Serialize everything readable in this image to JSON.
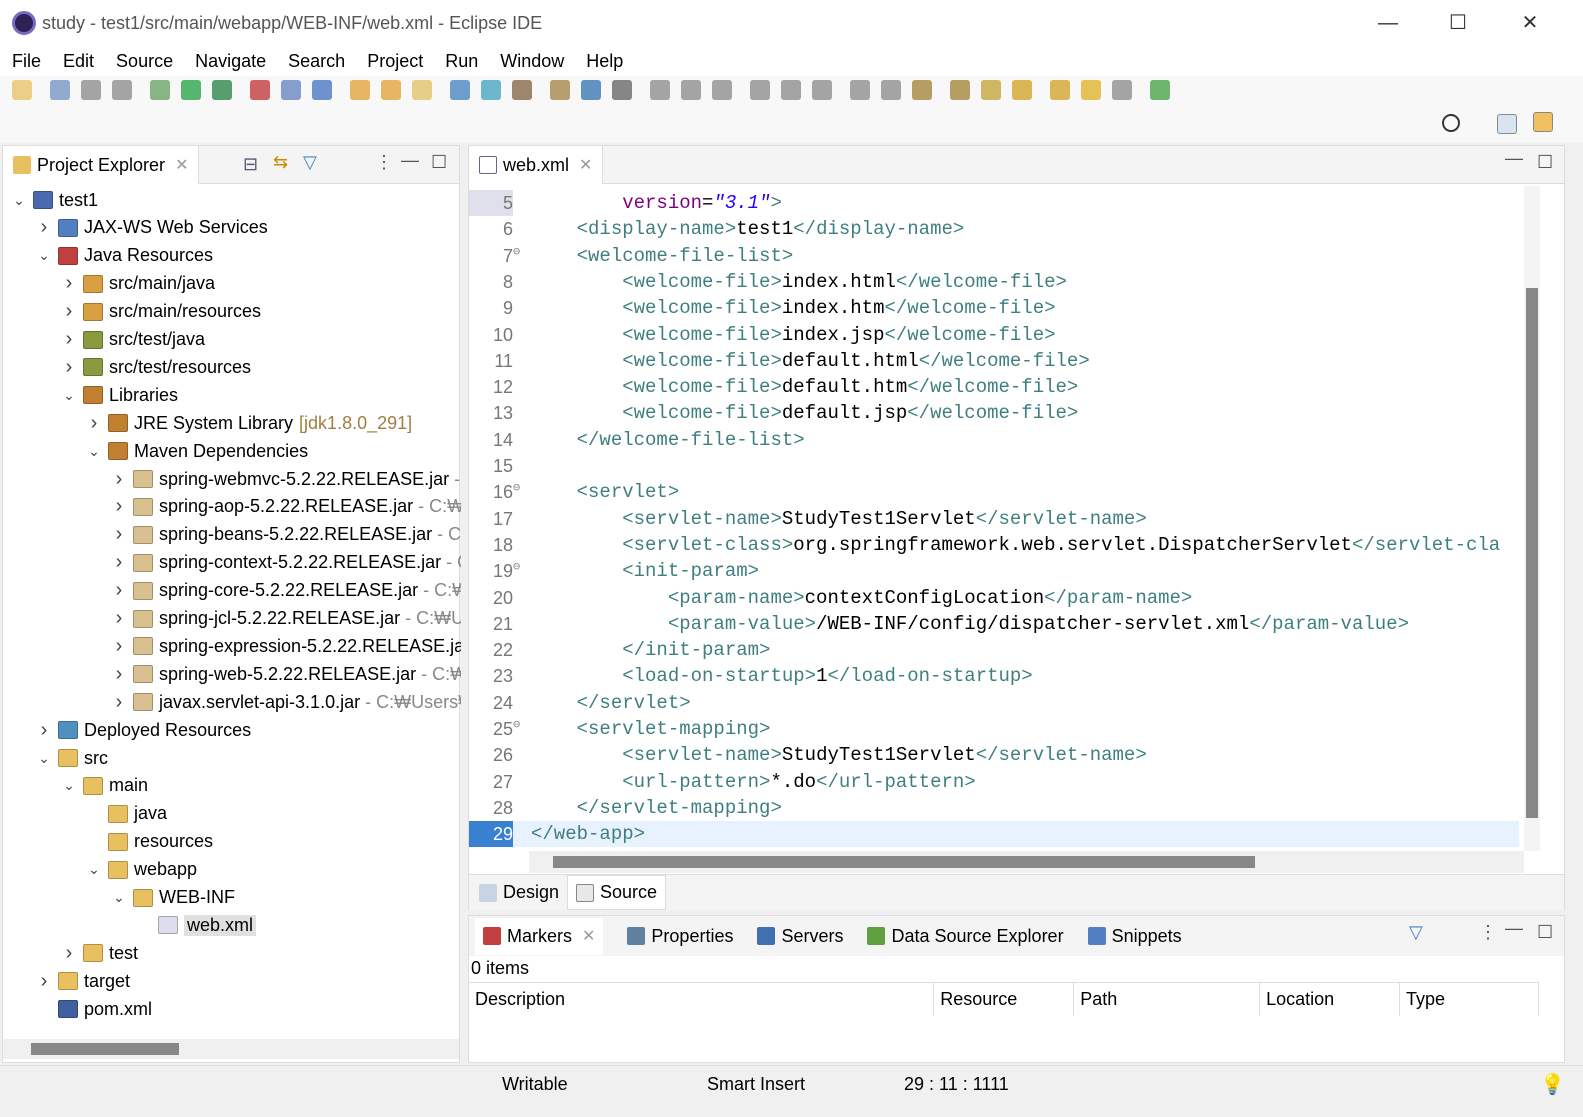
{
  "window": {
    "title": "study - test1/src/main/webapp/WEB-INF/web.xml - Eclipse IDE",
    "minimize": "—",
    "maximize": "☐",
    "close": "✕"
  },
  "menu": [
    "File",
    "Edit",
    "Source",
    "Navigate",
    "Search",
    "Project",
    "Run",
    "Window",
    "Help"
  ],
  "explorer": {
    "tab": "Project Explorer",
    "tree": [
      {
        "d": 0,
        "tw": "v",
        "icon": "project",
        "label": "test1"
      },
      {
        "d": 1,
        "tw": ">",
        "icon": "webservices",
        "label": "JAX-WS Web Services"
      },
      {
        "d": 1,
        "tw": "v",
        "icon": "javares",
        "label": "Java Resources"
      },
      {
        "d": 2,
        "tw": ">",
        "icon": "srcfolder",
        "label": "src/main/java"
      },
      {
        "d": 2,
        "tw": ">",
        "icon": "srcfolder",
        "label": "src/main/resources"
      },
      {
        "d": 2,
        "tw": ">",
        "icon": "testfolder",
        "label": "src/test/java"
      },
      {
        "d": 2,
        "tw": ">",
        "icon": "testfolder",
        "label": "src/test/resources"
      },
      {
        "d": 2,
        "tw": "v",
        "icon": "library",
        "label": "Libraries"
      },
      {
        "d": 3,
        "tw": ">",
        "icon": "library",
        "label": "JRE System Library",
        "jdk": "[jdk1.8.0_291]"
      },
      {
        "d": 3,
        "tw": "v",
        "icon": "library",
        "label": "Maven Dependencies"
      },
      {
        "d": 4,
        "tw": ">",
        "icon": "jar",
        "label": "spring-webmvc-5.2.22.RELEASE.jar",
        "suffix": " -"
      },
      {
        "d": 4,
        "tw": ">",
        "icon": "jar",
        "label": "spring-aop-5.2.22.RELEASE.jar",
        "suffix": " - C:₩U"
      },
      {
        "d": 4,
        "tw": ">",
        "icon": "jar",
        "label": "spring-beans-5.2.22.RELEASE.jar",
        "suffix": " - C:₩"
      },
      {
        "d": 4,
        "tw": ">",
        "icon": "jar",
        "label": "spring-context-5.2.22.RELEASE.jar",
        "suffix": " - C"
      },
      {
        "d": 4,
        "tw": ">",
        "icon": "jar",
        "label": "spring-core-5.2.22.RELEASE.jar",
        "suffix": " - C:₩"
      },
      {
        "d": 4,
        "tw": ">",
        "icon": "jar",
        "label": "spring-jcl-5.2.22.RELEASE.jar",
        "suffix": " - C:₩Us"
      },
      {
        "d": 4,
        "tw": ">",
        "icon": "jar",
        "label": "spring-expression-5.2.22.RELEASE.jar",
        "suffix": ""
      },
      {
        "d": 4,
        "tw": ">",
        "icon": "jar",
        "label": "spring-web-5.2.22.RELEASE.jar",
        "suffix": " - C:₩U"
      },
      {
        "d": 4,
        "tw": ">",
        "icon": "jar",
        "label": "javax.servlet-api-3.1.0.jar",
        "suffix": " - C:₩Users₩"
      },
      {
        "d": 1,
        "tw": ">",
        "icon": "deployed",
        "label": "Deployed Resources"
      },
      {
        "d": 1,
        "tw": "v",
        "icon": "folder",
        "label": "src"
      },
      {
        "d": 2,
        "tw": "v",
        "icon": "folder",
        "label": "main"
      },
      {
        "d": 3,
        "tw": "",
        "icon": "folder",
        "label": "java"
      },
      {
        "d": 3,
        "tw": "",
        "icon": "folder",
        "label": "resources"
      },
      {
        "d": 3,
        "tw": "v",
        "icon": "folder",
        "label": "webapp"
      },
      {
        "d": 4,
        "tw": "v",
        "icon": "folder",
        "label": "WEB-INF"
      },
      {
        "d": 5,
        "tw": "",
        "icon": "xml",
        "label": "web.xml",
        "selected": true
      },
      {
        "d": 2,
        "tw": ">",
        "icon": "folder",
        "label": "test"
      },
      {
        "d": 1,
        "tw": ">",
        "icon": "folder",
        "label": "target"
      },
      {
        "d": 1,
        "tw": "",
        "icon": "maven",
        "label": "pom.xml"
      }
    ]
  },
  "editor": {
    "tab": "web.xml",
    "lines": [
      {
        "n": "5",
        "fold": "",
        "segs": [
          [
            "txt",
            "        "
          ],
          [
            "attr",
            "version"
          ],
          [
            "txt",
            "="
          ],
          [
            "val",
            "\"3.1\""
          ],
          [
            "tag",
            ">"
          ]
        ]
      },
      {
        "n": "6",
        "fold": "",
        "segs": [
          [
            "txt",
            "    "
          ],
          [
            "tag",
            "<display-name>"
          ],
          [
            "txt",
            "test1"
          ],
          [
            "tag",
            "</display-name>"
          ]
        ]
      },
      {
        "n": "7",
        "fold": "⊖",
        "segs": [
          [
            "txt",
            "    "
          ],
          [
            "tag",
            "<welcome-file-list>"
          ]
        ]
      },
      {
        "n": "8",
        "fold": "",
        "segs": [
          [
            "txt",
            "        "
          ],
          [
            "tag",
            "<welcome-file>"
          ],
          [
            "txt",
            "index.html"
          ],
          [
            "tag",
            "</welcome-file>"
          ]
        ]
      },
      {
        "n": "9",
        "fold": "",
        "segs": [
          [
            "txt",
            "        "
          ],
          [
            "tag",
            "<welcome-file>"
          ],
          [
            "txt",
            "index.htm"
          ],
          [
            "tag",
            "</welcome-file>"
          ]
        ]
      },
      {
        "n": "10",
        "fold": "",
        "segs": [
          [
            "txt",
            "        "
          ],
          [
            "tag",
            "<welcome-file>"
          ],
          [
            "txt",
            "index.jsp"
          ],
          [
            "tag",
            "</welcome-file>"
          ]
        ]
      },
      {
        "n": "11",
        "fold": "",
        "segs": [
          [
            "txt",
            "        "
          ],
          [
            "tag",
            "<welcome-file>"
          ],
          [
            "txt",
            "default.html"
          ],
          [
            "tag",
            "</welcome-file>"
          ]
        ]
      },
      {
        "n": "12",
        "fold": "",
        "segs": [
          [
            "txt",
            "        "
          ],
          [
            "tag",
            "<welcome-file>"
          ],
          [
            "txt",
            "default.htm"
          ],
          [
            "tag",
            "</welcome-file>"
          ]
        ]
      },
      {
        "n": "13",
        "fold": "",
        "segs": [
          [
            "txt",
            "        "
          ],
          [
            "tag",
            "<welcome-file>"
          ],
          [
            "txt",
            "default.jsp"
          ],
          [
            "tag",
            "</welcome-file>"
          ]
        ]
      },
      {
        "n": "14",
        "fold": "",
        "segs": [
          [
            "txt",
            "    "
          ],
          [
            "tag",
            "</welcome-file-list>"
          ]
        ]
      },
      {
        "n": "15",
        "fold": "",
        "segs": []
      },
      {
        "n": "16",
        "fold": "⊖",
        "segs": [
          [
            "txt",
            "    "
          ],
          [
            "tag",
            "<servlet>"
          ]
        ]
      },
      {
        "n": "17",
        "fold": "",
        "segs": [
          [
            "txt",
            "        "
          ],
          [
            "tag",
            "<servlet-name>"
          ],
          [
            "txt",
            "StudyTest1Servlet"
          ],
          [
            "tag",
            "</servlet-name>"
          ]
        ]
      },
      {
        "n": "18",
        "fold": "",
        "segs": [
          [
            "txt",
            "        "
          ],
          [
            "tag",
            "<servlet-class>"
          ],
          [
            "txt",
            "org.springframework.web.servlet.DispatcherServlet"
          ],
          [
            "tag",
            "</servlet-cla"
          ]
        ]
      },
      {
        "n": "19",
        "fold": "⊖",
        "segs": [
          [
            "txt",
            "        "
          ],
          [
            "tag",
            "<init-param>"
          ]
        ]
      },
      {
        "n": "20",
        "fold": "",
        "segs": [
          [
            "txt",
            "            "
          ],
          [
            "tag",
            "<param-name>"
          ],
          [
            "txt",
            "contextConfigLocation"
          ],
          [
            "tag",
            "</param-name>"
          ]
        ]
      },
      {
        "n": "21",
        "fold": "",
        "segs": [
          [
            "txt",
            "            "
          ],
          [
            "tag",
            "<param-value>"
          ],
          [
            "txt",
            "/WEB-INF/config/dispatcher-servlet.xml"
          ],
          [
            "tag",
            "</param-value>"
          ]
        ]
      },
      {
        "n": "22",
        "fold": "",
        "segs": [
          [
            "txt",
            "        "
          ],
          [
            "tag",
            "</init-param>"
          ]
        ]
      },
      {
        "n": "23",
        "fold": "",
        "segs": [
          [
            "txt",
            "        "
          ],
          [
            "tag",
            "<load-on-startup>"
          ],
          [
            "txt",
            "1"
          ],
          [
            "tag",
            "</load-on-startup>"
          ]
        ]
      },
      {
        "n": "24",
        "fold": "",
        "segs": [
          [
            "txt",
            "    "
          ],
          [
            "tag",
            "</servlet>"
          ]
        ]
      },
      {
        "n": "25",
        "fold": "⊖",
        "segs": [
          [
            "txt",
            "    "
          ],
          [
            "tag",
            "<servlet-mapping>"
          ]
        ]
      },
      {
        "n": "26",
        "fold": "",
        "segs": [
          [
            "txt",
            "        "
          ],
          [
            "tag",
            "<servlet-name>"
          ],
          [
            "txt",
            "StudyTest1Servlet"
          ],
          [
            "tag",
            "</servlet-name>"
          ]
        ]
      },
      {
        "n": "27",
        "fold": "",
        "segs": [
          [
            "txt",
            "        "
          ],
          [
            "tag",
            "<url-pattern>"
          ],
          [
            "txt",
            "*.do"
          ],
          [
            "tag",
            "</url-pattern>"
          ]
        ]
      },
      {
        "n": "28",
        "fold": "",
        "segs": [
          [
            "txt",
            "    "
          ],
          [
            "tag",
            "</servlet-mapping>"
          ]
        ]
      },
      {
        "n": "29",
        "fold": "",
        "segs": [
          [
            "tag",
            "</web-app>"
          ]
        ],
        "current": true
      }
    ],
    "bottom_tabs": {
      "design": "Design",
      "source": "Source"
    }
  },
  "markers": {
    "tabs": [
      "Markers",
      "Properties",
      "Servers",
      "Data Source Explorer",
      "Snippets"
    ],
    "count": "0 items",
    "columns": [
      "Description",
      "Resource",
      "Path",
      "Location",
      "Type"
    ]
  },
  "status": {
    "mode": "Writable",
    "insert": "Smart Insert",
    "position": "29 : 11 : 1111"
  }
}
